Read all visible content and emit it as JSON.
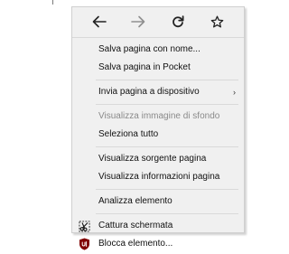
{
  "menu": {
    "nav": {
      "back_icon": "arrow-left-icon",
      "forward_icon": "arrow-right-icon",
      "reload_icon": "reload-icon",
      "bookmark_icon": "star-icon"
    },
    "items": {
      "save_as": "Salva pagina con nome...",
      "save_pocket": "Salva pagina in Pocket",
      "send_to_device": "Invia pagina a dispositivo",
      "view_background": "Visualizza immagine di sfondo",
      "select_all": "Seleziona tutto",
      "view_source": "Visualizza sorgente pagina",
      "view_info": "Visualizza informazioni pagina",
      "inspect": "Analizza elemento",
      "screenshot": "Cattura schermata",
      "block_element": "Blocca elemento..."
    },
    "colors": {
      "background": "#f0f0f0",
      "disabled_text": "#8a8a8a",
      "ublock_red": "#800000"
    }
  }
}
